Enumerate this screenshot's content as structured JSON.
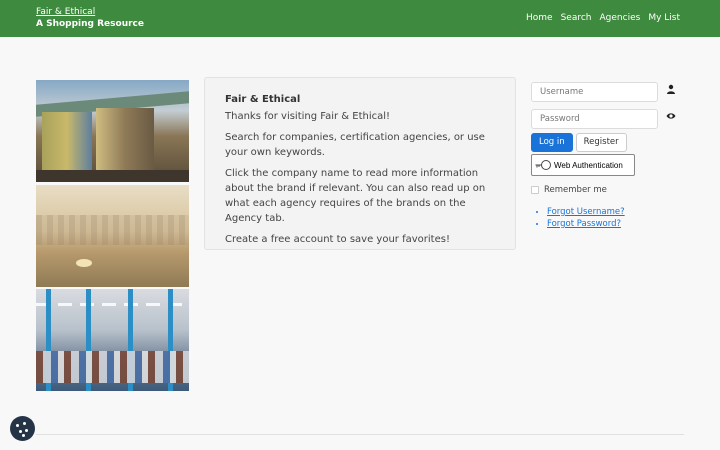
{
  "header": {
    "brand_link": "Fair & Ethical",
    "brand_subtitle": "A Shopping Resource",
    "nav": [
      "Home",
      "Search",
      "Agencies",
      "My List"
    ]
  },
  "intro": {
    "title": "Fair & Ethical",
    "paragraphs": [
      "Thanks for visiting Fair & Ethical!",
      "Search for companies, certification agencies, or use your own keywords.",
      "Click the company name to read more information about the brand if relevant. You can also read up on what each agency requires of the brands on the Agency tab.",
      "Create a free account to save your favorites!"
    ]
  },
  "login": {
    "username_placeholder": "Username",
    "password_placeholder": "Password",
    "login_label": "Log in",
    "register_label": "Register",
    "webauthn_label": "Web Authentication",
    "remember_label": "Remember me",
    "forgot_username": "Forgot Username?",
    "forgot_password": "Forgot Password?"
  },
  "icons": {
    "user": "user-icon",
    "password_reveal": "eye-icon",
    "webauthn": "key-icon",
    "cookie": "cookie-icon"
  },
  "colors": {
    "header_bg": "#3e8a3e",
    "primary": "#1a73d9",
    "cookie_bg": "#253447"
  }
}
